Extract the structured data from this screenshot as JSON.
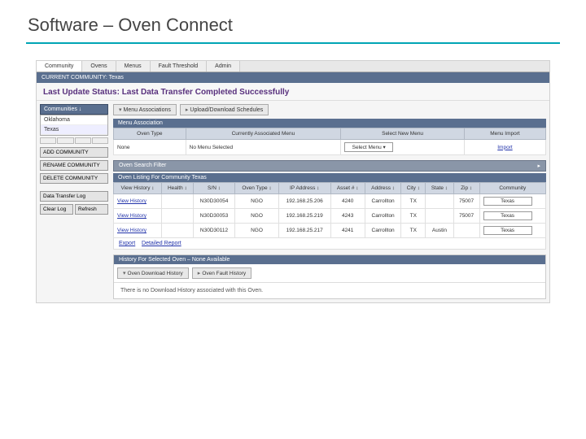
{
  "page_title": "Software – Oven Connect",
  "tabs": [
    "Community",
    "Ovens",
    "Menus",
    "Fault Threshold",
    "Admin"
  ],
  "banner": "CURRENT COMMUNITY: Texas",
  "status_prefix": "Last Update Status: ",
  "status_text": "Last Data Transfer Completed Successfully",
  "sidebar": {
    "communities_label": "Communities ↓",
    "items": [
      "Oklahoma",
      "Texas"
    ],
    "buttons": {
      "add": "ADD COMMUNITY",
      "rename": "RENAME COMMUNITY",
      "delete": "DELETE COMMUNITY",
      "log": "Data Transfer Log",
      "clear": "Clear Log",
      "refresh": "Refresh"
    }
  },
  "main": {
    "top_buttons": {
      "menu_assoc": "Menu Associations",
      "schedules": "Upload/Download Schedules"
    },
    "menu_assoc_head": "Menu Association",
    "menu_assoc_cols": [
      "Oven Type",
      "Currently Associated Menu",
      "Select New Menu",
      "Menu Import"
    ],
    "menu_assoc_row": {
      "type": "None",
      "current": "No Menu Selected",
      "select_label": "Select Menu ▾",
      "import": "Import"
    },
    "filter_label": "Oven Search Filter",
    "listing_head": "Oven Listing For Community Texas",
    "listing_cols": [
      "View History ↕",
      "Health ↕",
      "S/N ↕",
      "Oven Type ↕",
      "IP Address ↕",
      "Asset # ↕",
      "Address ↕",
      "City ↕",
      "State ↕",
      "Zip ↕",
      "Community"
    ],
    "rows": [
      {
        "view": "View History",
        "health": "",
        "sn": "N30D30054",
        "type": "NGO",
        "ip": "192.168.25.206",
        "asset": "4240",
        "addr": "Carrollton",
        "city": "TX",
        "state": "",
        "zip": "75007",
        "community": "Texas"
      },
      {
        "view": "View History",
        "health": "",
        "sn": "N30D30053",
        "type": "NGO",
        "ip": "192.168.25.219",
        "asset": "4243",
        "addr": "Carrollton",
        "city": "TX",
        "state": "",
        "zip": "75007",
        "community": "Texas"
      },
      {
        "view": "View History",
        "health": "",
        "sn": "N30D30112",
        "type": "NGO",
        "ip": "192.168.25.217",
        "asset": "4241",
        "addr": "Carrollton",
        "city": "TX",
        "state": "Austin",
        "zip": "",
        "community": "Texas"
      }
    ],
    "footer": {
      "export": "Export",
      "delete_report": "Detailed Report"
    },
    "history": {
      "head": "History For Selected Oven – None Available",
      "t1": "Oven Download History",
      "t2": "Oven Fault History",
      "body": "There is no Download History associated with this Oven."
    }
  }
}
